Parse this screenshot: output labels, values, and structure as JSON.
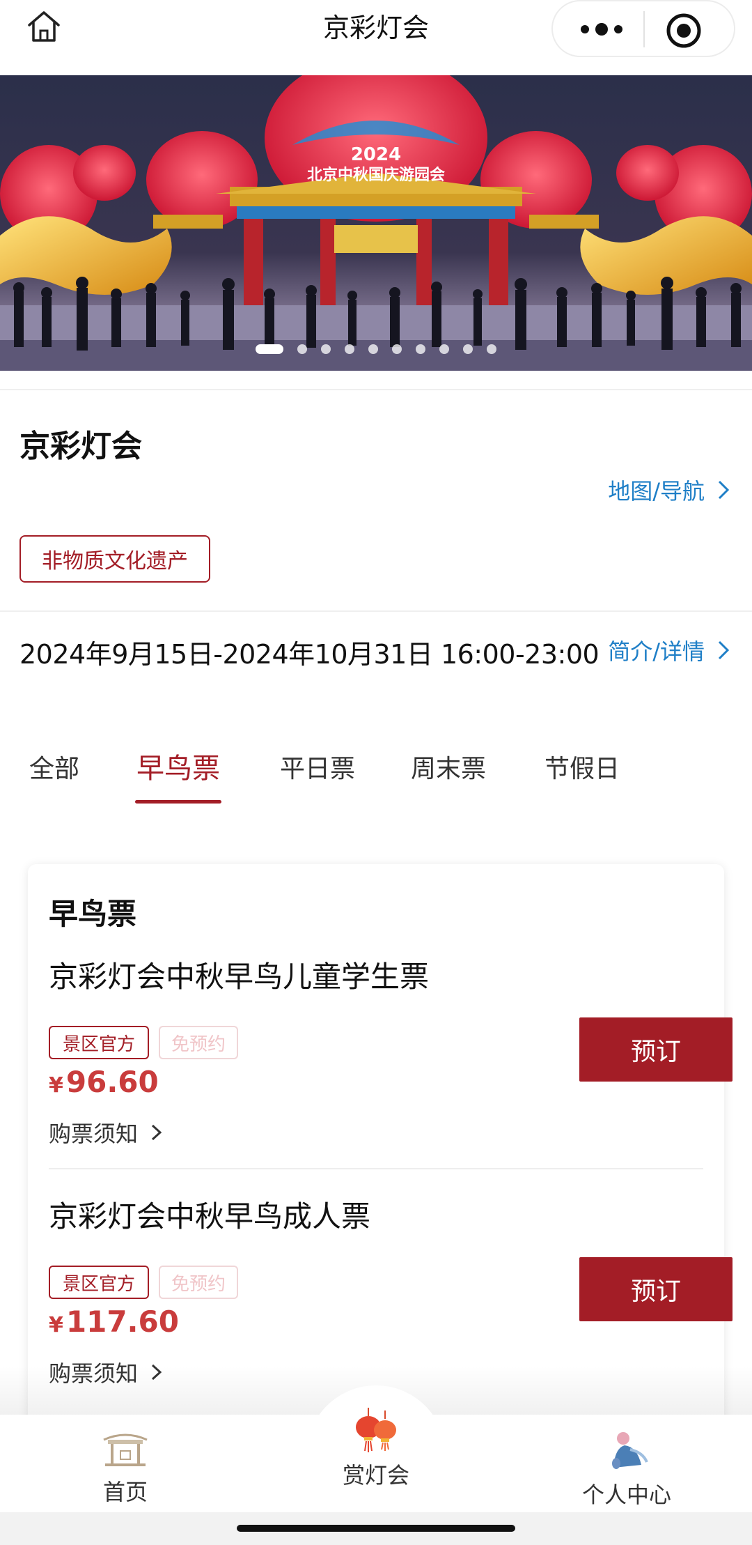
{
  "navbar": {
    "title": "京彩灯会"
  },
  "banner": {
    "caption_year": "2024",
    "caption_text": "北京中秋国庆游园会",
    "slide_count": 10,
    "active_slide": 1
  },
  "info": {
    "name": "京彩灯会",
    "map_link": "地图/导航",
    "tag": "非物质文化遗产",
    "date": "2024年9月15日-2024年10月31日 16:00-23:00",
    "intro_link": "简介/详情"
  },
  "tabs": [
    {
      "label": "全部"
    },
    {
      "label": "早鸟票",
      "active": true
    },
    {
      "label": "平日票"
    },
    {
      "label": "周末票"
    },
    {
      "label": "节假日"
    }
  ],
  "card": {
    "title": "早鸟票",
    "tickets": [
      {
        "name": "京彩灯会中秋早鸟儿童学生票",
        "badge_official": "景区官方",
        "badge_free": "免预约",
        "currency": "¥",
        "price": "96.60",
        "notice": "购票须知",
        "book": "预订"
      },
      {
        "name": "京彩灯会中秋早鸟成人票",
        "badge_official": "景区官方",
        "badge_free": "免预约",
        "currency": "¥",
        "price": "117.60",
        "notice": "购票须知",
        "book": "预订"
      }
    ]
  },
  "tabbar": [
    {
      "label": "首页",
      "icon": "pavilion-icon"
    },
    {
      "label": "赏灯会",
      "icon": "lantern-icon"
    },
    {
      "label": "个人中心",
      "icon": "avatar-icon"
    }
  ],
  "colors": {
    "brand_red": "#a31d26",
    "price_red": "#c93c3c",
    "link_blue": "#1f7fc7"
  }
}
